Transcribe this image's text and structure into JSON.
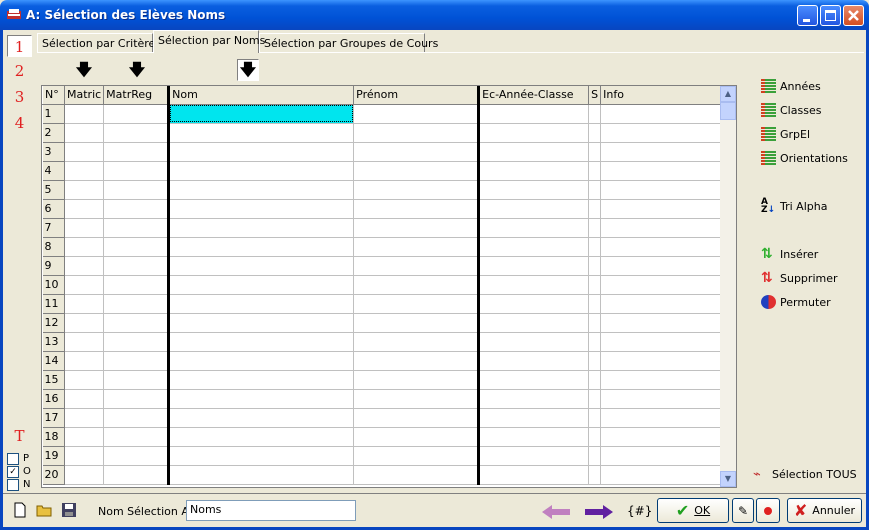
{
  "window": {
    "title": "A: Sélection des Elèves Noms"
  },
  "tabs": [
    "Sélection par Critères",
    "Sélection par Noms",
    "Sélection par Groupes de Cours"
  ],
  "left_buttons": [
    "1",
    "2",
    "3",
    "4"
  ],
  "left_t": "T",
  "checks": [
    {
      "label": "P",
      "checked": false
    },
    {
      "label": "O",
      "checked": true
    },
    {
      "label": "N",
      "checked": false
    }
  ],
  "grid": {
    "columns": [
      "N°",
      "Matric",
      "MatrReg",
      "Nom",
      "Prénom",
      "Ec-Année-Classe",
      "S",
      "Info"
    ],
    "rows": [
      "1",
      "2",
      "3",
      "4",
      "5",
      "6",
      "7",
      "8",
      "9",
      "10",
      "11",
      "12",
      "13",
      "14",
      "15",
      "16",
      "17",
      "18",
      "19",
      "20"
    ]
  },
  "side": {
    "annees": "Années",
    "classes": "Classes",
    "grpel": "GrpEl",
    "orientations": "Orientations",
    "tri": "Tri Alpha",
    "inserer": "Insérer",
    "supprimer": "Supprimer",
    "permuter": "Permuter",
    "selection_tous": "Sélection TOUS"
  },
  "bottom": {
    "label": "Nom Sélection A :",
    "value": "Noms",
    "hash": "{#}",
    "ok": "OK",
    "annuler": "Annuler"
  },
  "colors": {
    "title": "#0052d6",
    "current_cell": "#00e5ee",
    "numbers": "#e02020"
  }
}
